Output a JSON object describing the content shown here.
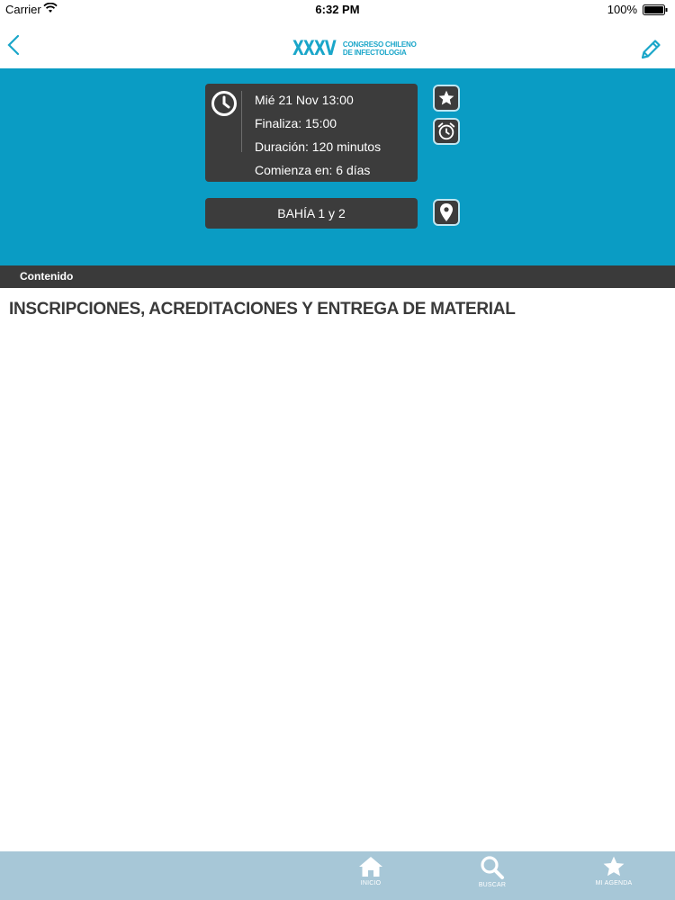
{
  "status_bar": {
    "carrier": "Carrier",
    "time": "6:32 PM",
    "battery": "100%"
  },
  "nav": {
    "back_icon": "chevron-left-icon",
    "edit_icon": "pencil-icon",
    "logo": {
      "roman": "XXXV",
      "line1": "CONGRESO CHILENO",
      "line2": "DE INFECTOLOGIA"
    }
  },
  "event": {
    "date_line": "Mié 21  Nov  13:00",
    "end_line": "Finaliza: 15:00",
    "duration_line": "Duración: 120 minutos",
    "starts_in_line": "Comienza en: 6 días",
    "location": "BAHÍA 1 y 2",
    "title": "INSCRIPCIONES, ACREDITACIONES Y ENTREGA DE MATERIAL"
  },
  "section": {
    "label": "Contenido"
  },
  "tabs": [
    {
      "label": "INICIO",
      "icon": "home-icon"
    },
    {
      "label": "BUSCAR",
      "icon": "search-icon"
    },
    {
      "label": "MI AGENDA",
      "icon": "star-icon"
    }
  ],
  "colors": {
    "accent": "#0a9cc4",
    "logo": "#1aa6c9",
    "card": "#3c3c3c",
    "section_bar": "#3a3a3a",
    "tab_bar": "#a7c7d7"
  }
}
